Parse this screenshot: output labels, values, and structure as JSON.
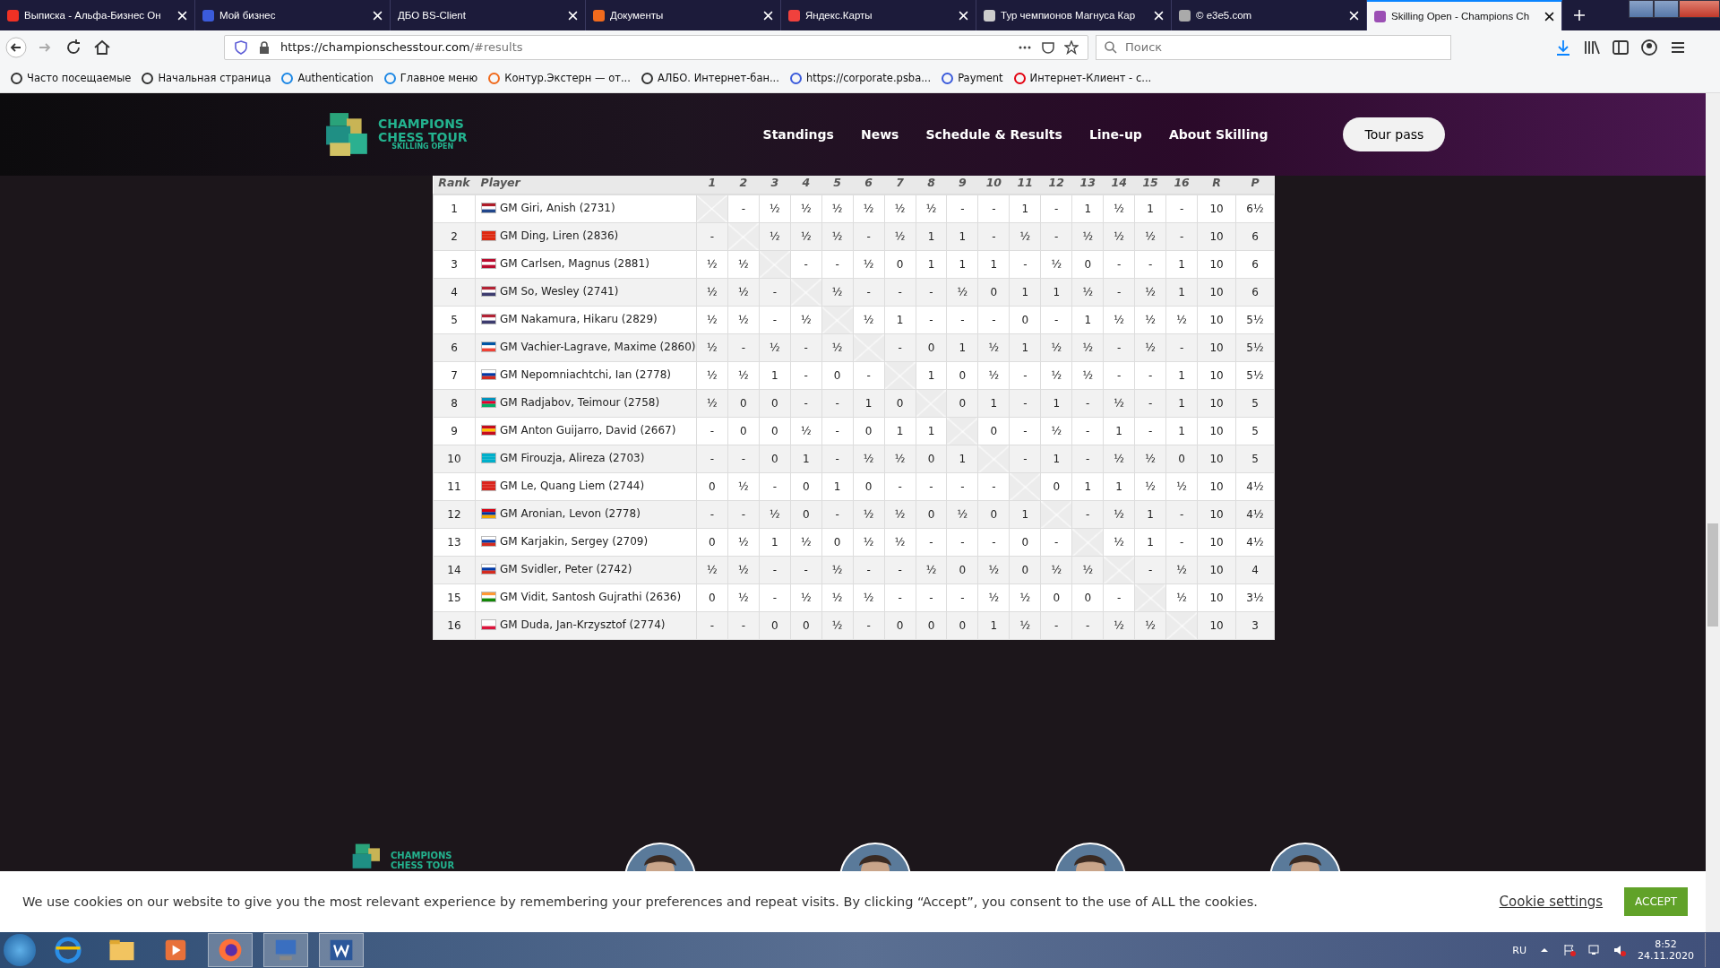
{
  "browser": {
    "tabs": [
      {
        "title": "Выписка - Альфа-Бизнес Он",
        "selected": false,
        "color": "#ef3124"
      },
      {
        "title": "Мой бизнес",
        "selected": false,
        "color": "#3b5bdb"
      },
      {
        "title": "ДБО BS-Client",
        "selected": false
      },
      {
        "title": "Документы",
        "selected": false,
        "color": "#f06a1d"
      },
      {
        "title": "Яндекс.Карты",
        "selected": false,
        "color": "#f0413d"
      },
      {
        "title": "Тур чемпионов Магнуса Кар",
        "selected": false,
        "color": "#cccccc"
      },
      {
        "title": "© e3e5.com",
        "selected": false,
        "color": "#aaaaaa"
      },
      {
        "title": "Skilling Open - Champions Ch",
        "selected": true,
        "color": "#9b4fb4"
      }
    ],
    "url_host": "https://championschesstour.com",
    "url_path": "/#results",
    "search": {
      "placeholder": "Поиск"
    },
    "bookmarks": [
      {
        "label": "Часто посещаемые",
        "color": "#333333"
      },
      {
        "label": "Начальная страница",
        "color": "#333333"
      },
      {
        "label": "Authentication",
        "color": "#1e88e5"
      },
      {
        "label": "Главное меню",
        "color": "#1e88e5"
      },
      {
        "label": "Контур.Экстерн — от...",
        "color": "#f06a1d"
      },
      {
        "label": "АЛБО. Интернет-бан...",
        "color": "#333333"
      },
      {
        "label": "https://corporate.psba...",
        "color": "#3b5bdb"
      },
      {
        "label": "Payment",
        "color": "#3b5bdb"
      },
      {
        "label": "Интернет-Клиент - с...",
        "color": "#e3000f"
      }
    ]
  },
  "site": {
    "logo": [
      "CHAMPIONS",
      "CHESS TOUR",
      "SKILLING OPEN"
    ],
    "nav": [
      "Standings",
      "News",
      "Schedule & Results",
      "Line-up",
      "About Skilling"
    ],
    "cta": "Tour pass"
  },
  "table": {
    "columns": [
      "Rank",
      "Player",
      "1",
      "2",
      "3",
      "4",
      "5",
      "6",
      "7",
      "8",
      "9",
      "10",
      "11",
      "12",
      "13",
      "14",
      "15",
      "16",
      "R",
      "P"
    ],
    "rows": [
      {
        "rank": "1",
        "kind": "nl",
        "player": "GM Giri, Anish (2731)",
        "results": [
          "-",
          "½",
          "½",
          "½",
          "½",
          "½",
          "½",
          "-",
          "-",
          "1",
          "-",
          "1",
          "½",
          "1",
          "-"
        ],
        "r": "10",
        "p": "6½"
      },
      {
        "rank": "2",
        "kind": "cn",
        "player": "GM Ding, Liren (2836)",
        "results": [
          "-",
          "½",
          "½",
          "½",
          "-",
          "½",
          "1",
          "1",
          "-",
          "½",
          "-",
          "½",
          "½",
          "½",
          "-"
        ],
        "r": "10",
        "p": "6"
      },
      {
        "rank": "3",
        "kind": "no",
        "player": "GM Carlsen, Magnus (2881)",
        "results": [
          "½",
          "½",
          "-",
          "-",
          "½",
          "0",
          "1",
          "1",
          "1",
          "-",
          "½",
          "0",
          "-",
          "-",
          "1"
        ],
        "r": "10",
        "p": "6"
      },
      {
        "rank": "4",
        "kind": "us",
        "player": "GM So, Wesley (2741)",
        "results": [
          "½",
          "½",
          "-",
          "½",
          "-",
          "-",
          "-",
          "½",
          "0",
          "1",
          "1",
          "½",
          "-",
          "½",
          "1"
        ],
        "r": "10",
        "p": "6"
      },
      {
        "rank": "5",
        "kind": "us",
        "player": "GM Nakamura, Hikaru (2829)",
        "results": [
          "½",
          "½",
          "-",
          "½",
          "½",
          "1",
          "-",
          "-",
          "-",
          "0",
          "-",
          "1",
          "½",
          "½",
          "½"
        ],
        "r": "10",
        "p": "5½"
      },
      {
        "rank": "6",
        "kind": "fr",
        "player": "GM Vachier-Lagrave, Maxime (2860)",
        "results": [
          "½",
          "-",
          "½",
          "-",
          "½",
          "-",
          "0",
          "1",
          "½",
          "1",
          "½",
          "½",
          "-",
          "½",
          "-"
        ],
        "r": "10",
        "p": "5½"
      },
      {
        "rank": "7",
        "kind": "ru",
        "player": "GM Nepomniachtchi, Ian (2778)",
        "results": [
          "½",
          "½",
          "1",
          "-",
          "0",
          "-",
          "1",
          "0",
          "½",
          "-",
          "½",
          "½",
          "-",
          "-",
          "1"
        ],
        "r": "10",
        "p": "5½"
      },
      {
        "rank": "8",
        "kind": "az",
        "player": "GM Radjabov, Teimour (2758)",
        "results": [
          "½",
          "0",
          "0",
          "-",
          "-",
          "1",
          "0",
          "0",
          "1",
          "-",
          "1",
          "-",
          "½",
          "-",
          "1"
        ],
        "r": "10",
        "p": "5"
      },
      {
        "rank": "9",
        "kind": "es",
        "player": "GM Anton Guijarro, David (2667)",
        "results": [
          "-",
          "0",
          "0",
          "½",
          "-",
          "0",
          "1",
          "1",
          "0",
          "-",
          "½",
          "-",
          "1",
          "-",
          "1"
        ],
        "r": "10",
        "p": "5"
      },
      {
        "rank": "10",
        "kind": "kz",
        "player": "GM Firouzja, Alireza (2703)",
        "results": [
          "-",
          "-",
          "0",
          "1",
          "-",
          "½",
          "½",
          "0",
          "1",
          "-",
          "1",
          "-",
          "½",
          "½",
          "0"
        ],
        "r": "10",
        "p": "5"
      },
      {
        "rank": "11",
        "kind": "vn",
        "player": "GM Le, Quang Liem (2744)",
        "results": [
          "0",
          "½",
          "-",
          "0",
          "1",
          "0",
          "-",
          "-",
          "-",
          "-",
          "0",
          "1",
          "1",
          "½",
          "½"
        ],
        "r": "10",
        "p": "4½"
      },
      {
        "rank": "12",
        "kind": "am",
        "player": "GM Aronian, Levon (2778)",
        "results": [
          "-",
          "-",
          "½",
          "0",
          "-",
          "½",
          "½",
          "0",
          "½",
          "0",
          "1",
          "-",
          "½",
          "1",
          "-"
        ],
        "r": "10",
        "p": "4½"
      },
      {
        "rank": "13",
        "kind": "ru",
        "player": "GM Karjakin, Sergey (2709)",
        "results": [
          "0",
          "½",
          "1",
          "½",
          "0",
          "½",
          "½",
          "-",
          "-",
          "-",
          "0",
          "-",
          "½",
          "1",
          "-"
        ],
        "r": "10",
        "p": "4½"
      },
      {
        "rank": "14",
        "kind": "ru",
        "player": "GM Svidler, Peter (2742)",
        "results": [
          "½",
          "½",
          "-",
          "-",
          "½",
          "-",
          "-",
          "½",
          "0",
          "½",
          "0",
          "½",
          "½",
          "-",
          "½"
        ],
        "r": "10",
        "p": "4"
      },
      {
        "rank": "15",
        "kind": "in",
        "player": "GM Vidit, Santosh Gujrathi (2636)",
        "results": [
          "0",
          "½",
          "-",
          "½",
          "½",
          "½",
          "-",
          "-",
          "-",
          "½",
          "½",
          "0",
          "0",
          "-",
          "½"
        ],
        "r": "10",
        "p": "3½"
      },
      {
        "rank": "16",
        "kind": "pl",
        "player": "GM Duda, Jan-Krzysztof (2774)",
        "results": [
          "-",
          "-",
          "0",
          "0",
          "½",
          "-",
          "0",
          "0",
          "0",
          "1",
          "½",
          "-",
          "-",
          "½",
          "½"
        ],
        "r": "10",
        "p": "3"
      }
    ]
  },
  "footer": {
    "logo": [
      "CHAMPIONS",
      "CHESS TOUR"
    ],
    "avatars": [
      {
        "kind": "picture"
      },
      {
        "kind": "picture"
      },
      {
        "kind": "picture"
      },
      {
        "kind": "picture"
      }
    ]
  },
  "cookie": {
    "text": "We use cookies on our website to give you the most relevant experience by remembering your preferences and repeat visits. By clicking “Accept”, you consent to the use of ALL the cookies.",
    "settings": "Cookie settings",
    "accept": "ACCEPT"
  },
  "taskbar": {
    "lang": "RU",
    "time": "8:52",
    "date": "24.11.2020"
  }
}
